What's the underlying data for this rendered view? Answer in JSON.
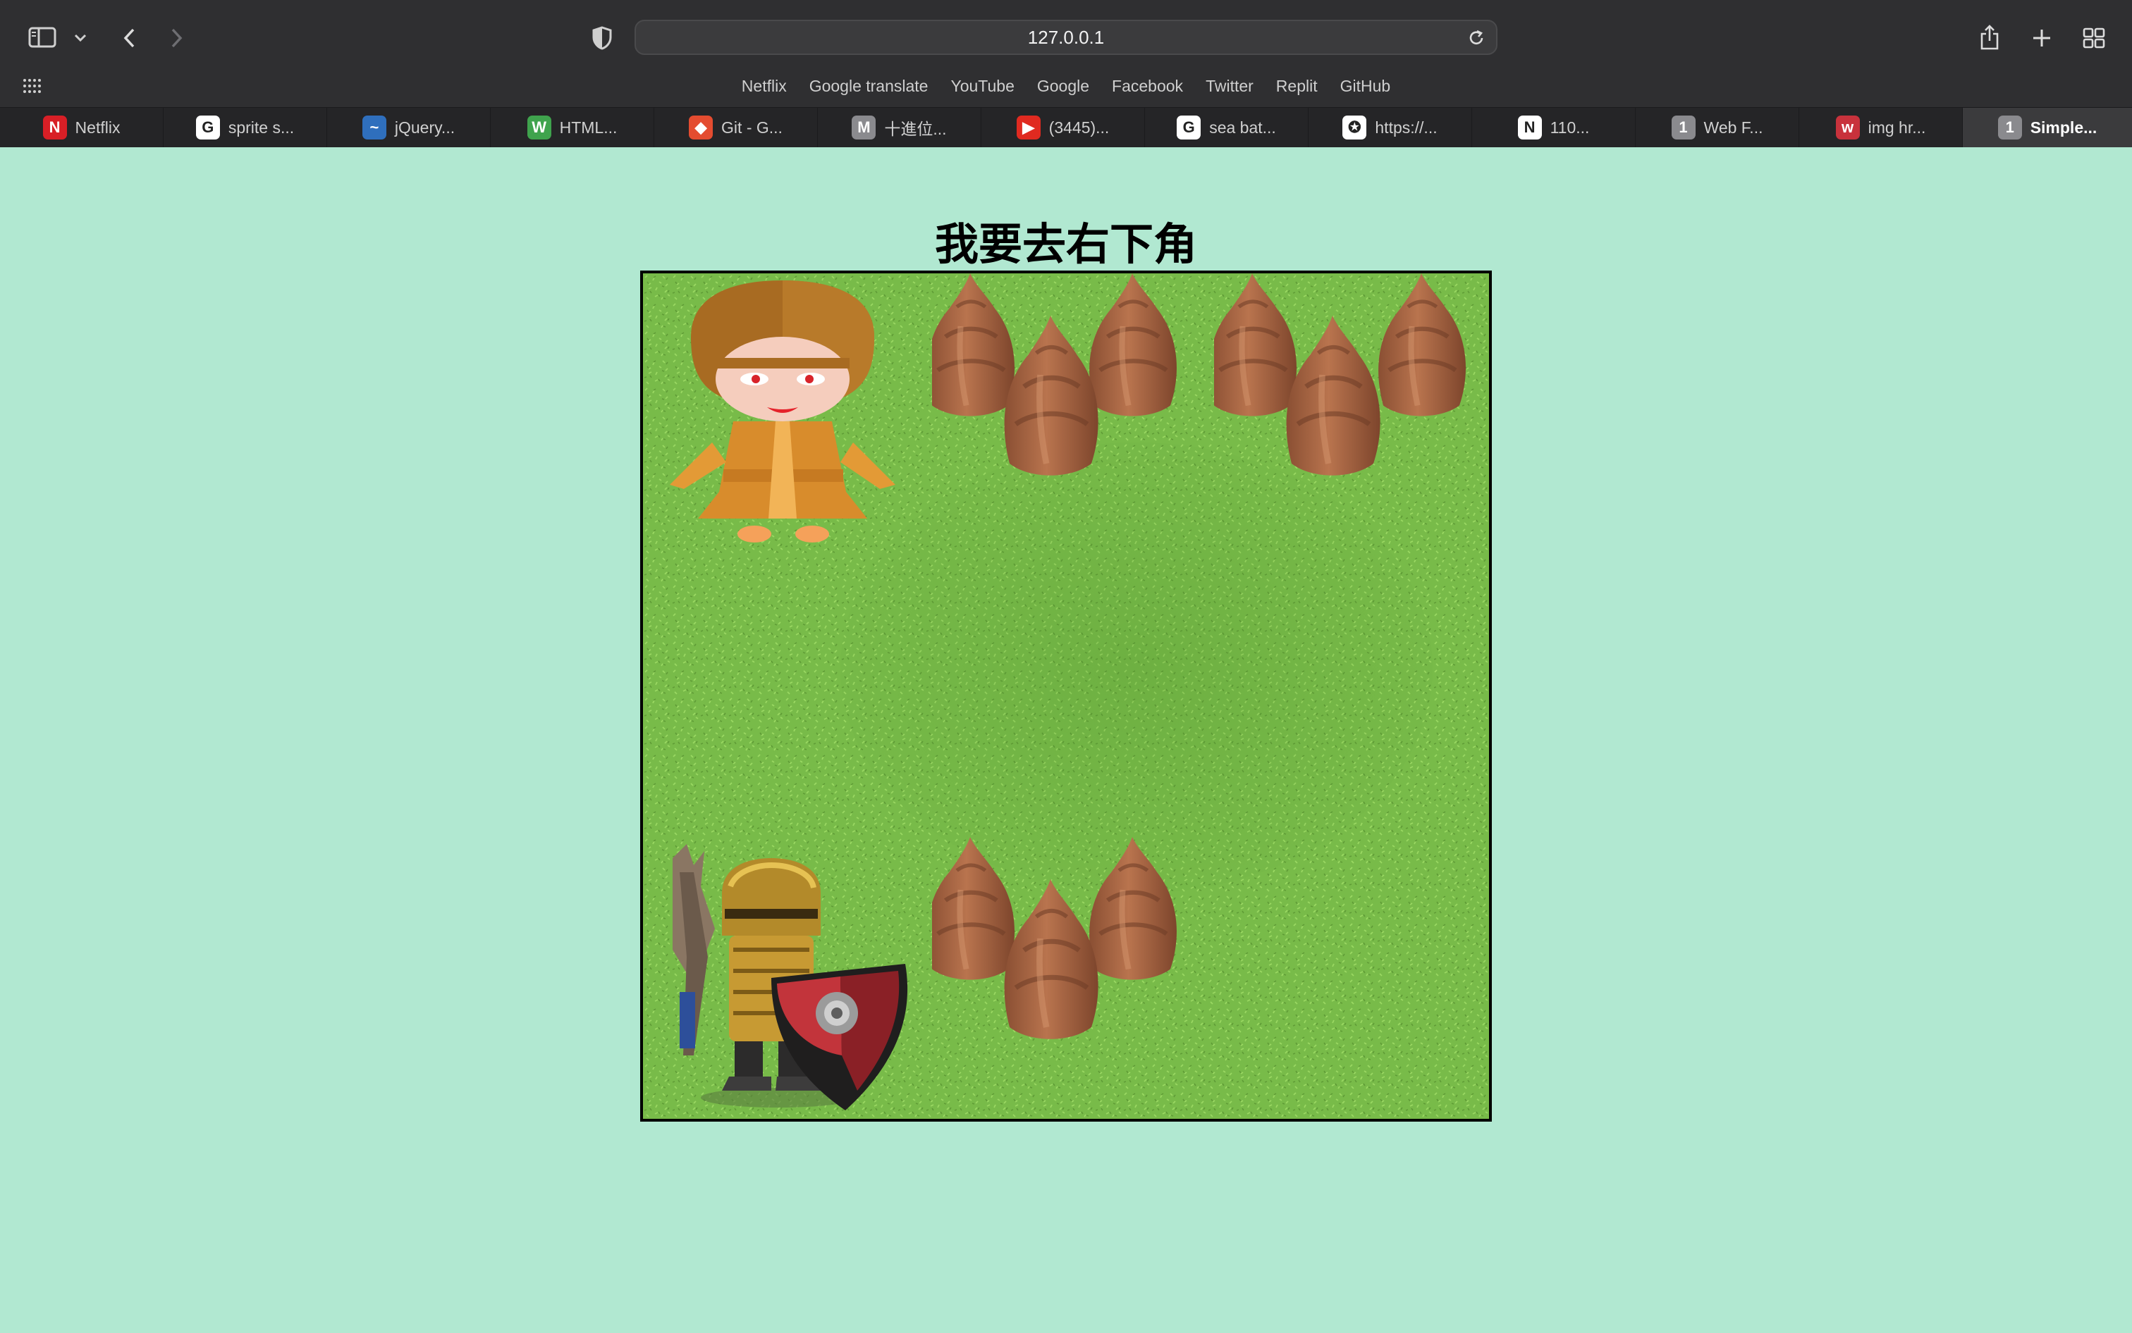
{
  "browser": {
    "url": "127.0.0.1",
    "favorites": [
      "Netflix",
      "Google translate",
      "YouTube",
      "Google",
      "Facebook",
      "Twitter",
      "Replit",
      "GitHub"
    ],
    "tabs": [
      {
        "label": "Netflix",
        "icon": "netflix-icon",
        "glyph": "N",
        "color": "#d81f26"
      },
      {
        "label": "sprite s...",
        "icon": "google-icon",
        "glyph": "G",
        "color": "#ffffff"
      },
      {
        "label": "jQuery...",
        "icon": "jquery-icon",
        "glyph": "~",
        "color": "#2f6fbd"
      },
      {
        "label": "HTML...",
        "icon": "w3schools-icon",
        "glyph": "W",
        "color": "#3fa34d"
      },
      {
        "label": "Git - G...",
        "icon": "git-icon",
        "glyph": "◆",
        "color": "#e44c30"
      },
      {
        "label": "十進位...",
        "icon": "medium-icon",
        "glyph": "M",
        "color": "#8a8a8e"
      },
      {
        "label": "(3445)...",
        "icon": "youtube-icon",
        "glyph": "▶",
        "color": "#e02a20"
      },
      {
        "label": "sea bat...",
        "icon": "google-icon",
        "glyph": "G",
        "color": "#ffffff"
      },
      {
        "label": "https://...",
        "icon": "globe-icon",
        "glyph": "✪",
        "color": "#ffffff"
      },
      {
        "label": "110...",
        "icon": "notion-icon",
        "glyph": "N",
        "color": "#ffffff"
      },
      {
        "label": "Web F...",
        "icon": "numbered-tab-icon",
        "glyph": "1",
        "color": "#8a8a8e"
      },
      {
        "label": "img hr...",
        "icon": "w-icon",
        "glyph": "w",
        "color": "#c8323c"
      },
      {
        "label": "Simple...",
        "icon": "numbered-tab-icon",
        "glyph": "1",
        "color": "#8a8a8e",
        "active": true
      }
    ]
  },
  "page": {
    "heading": "我要去右下角"
  },
  "colors": {
    "page_background": "#b1e8d1",
    "grass": "#79bd4b",
    "board_border": "#000000"
  },
  "game": {
    "grid": "3x3",
    "cells": [
      [
        "monk",
        "trees",
        "trees"
      ],
      [
        "grass",
        "grass",
        "grass"
      ],
      [
        "knight",
        "trees",
        "grass"
      ]
    ]
  }
}
